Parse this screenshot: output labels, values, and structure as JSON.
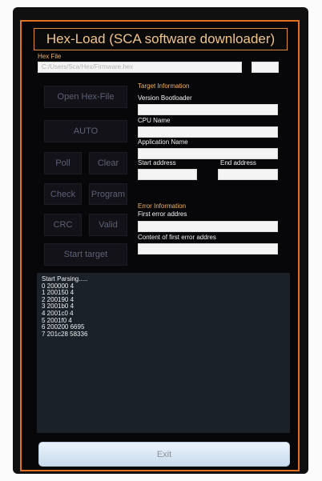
{
  "title": "Hex-Load (SCA software downloader)",
  "hex_file": {
    "label": "Hex File",
    "path_value": "C:/Users/Sca/Hex/Firmware.hex",
    "browse_label": ""
  },
  "buttons": {
    "open_hex_file": "Open Hex-File",
    "auto": "AUTO",
    "poll": "Poll",
    "clear": "Clear",
    "check": "Check",
    "program": "Program",
    "crc": "CRC",
    "valid": "Valid",
    "start_target": "Start target",
    "exit": "Exit"
  },
  "target_info": {
    "heading": "Target Information",
    "version_bootloader_label": "Version Bootloader",
    "version_bootloader_value": "",
    "cpu_name_label": "CPU Name",
    "cpu_name_value": "",
    "application_name_label": "Application Name",
    "application_name_value": "",
    "start_address_label": "Start address",
    "start_address_value": "",
    "end_address_label": "End address",
    "end_address_value": ""
  },
  "error_info": {
    "heading": "Error Information",
    "first_error_label": "First error addres",
    "first_error_value": "",
    "content_label": "Content of first error addres",
    "content_value": ""
  },
  "log_lines": [
    "Start Parsing.....",
    "0 200000 4",
    "1 200150 4",
    "2 200190 4",
    "3 2001b0 4",
    "4 2001c0 4",
    "5 2001f0 4",
    "6 200200 6695",
    "7 201c28 58336"
  ],
  "colors": {
    "frame_border": "#e0701f",
    "title_text": "#f0c489",
    "label_text": "#f0b35a",
    "log_background": "#1b2129",
    "disabled_button_text": "#5e6177"
  }
}
